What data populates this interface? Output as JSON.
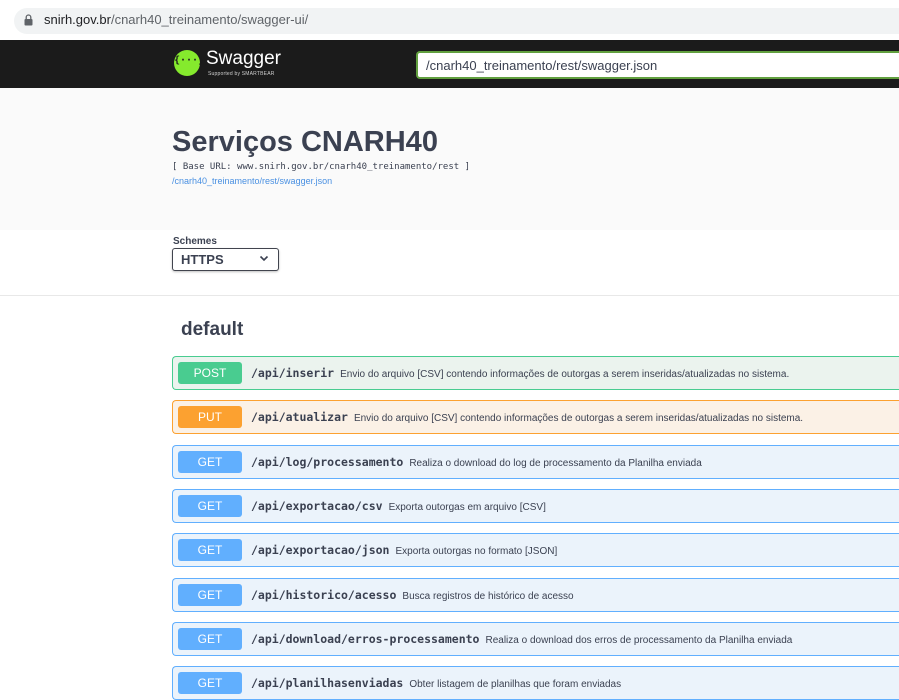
{
  "browser": {
    "url_host": "snirh.gov.br",
    "url_path": "/cnarh40_treinamento/swagger-ui/"
  },
  "topbar": {
    "logo_text": "Swagger",
    "logo_subtext": "Supported by SMARTBEAR",
    "logo_icon": "swagger-braces-icon",
    "spec_url": "/cnarh40_treinamento/rest/swagger.json"
  },
  "info": {
    "title": "Serviços CNARH40",
    "base_url": "[ Base URL: www.snirh.gov.br/cnarh40_treinamento/rest ]",
    "spec_link": "/cnarh40_treinamento/rest/swagger.json"
  },
  "schemes": {
    "label": "Schemes",
    "selected": "HTTPS"
  },
  "tag": {
    "name": "default"
  },
  "operations": [
    {
      "method": "POST",
      "path": "/api/inserir",
      "summary": "Envio do arquivo [CSV] contendo informações de outorgas a serem inseridas/atualizadas no sistema."
    },
    {
      "method": "PUT",
      "path": "/api/atualizar",
      "summary": "Envio do arquivo [CSV] contendo informações de outorgas a serem inseridas/atualizadas no sistema."
    },
    {
      "method": "GET",
      "path": "/api/log/processamento",
      "summary": "Realiza o download do log de processamento da Planilha enviada"
    },
    {
      "method": "GET",
      "path": "/api/exportacao/csv",
      "summary": "Exporta outorgas em arquivo [CSV]"
    },
    {
      "method": "GET",
      "path": "/api/exportacao/json",
      "summary": "Exporta outorgas no formato [JSON]"
    },
    {
      "method": "GET",
      "path": "/api/historico/acesso",
      "summary": "Busca registros de histórico de acesso"
    },
    {
      "method": "GET",
      "path": "/api/download/erros-processamento",
      "summary": "Realiza o download dos erros de processamento da Planilha enviada"
    },
    {
      "method": "GET",
      "path": "/api/planilhasenviadas",
      "summary": "Obter listagem de planilhas que foram enviadas"
    }
  ],
  "colors": {
    "post": "#49cc90",
    "put": "#fca130",
    "get": "#61affe",
    "topbar": "#1b1b1b",
    "logo": "#85ea2d"
  }
}
